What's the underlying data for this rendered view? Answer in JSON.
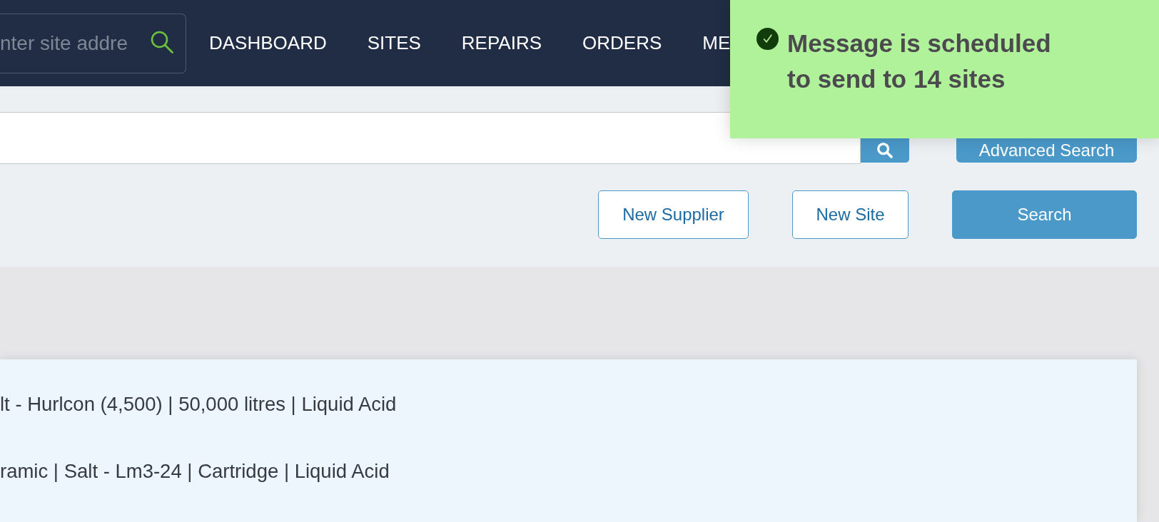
{
  "navbar": {
    "site_search": {
      "placeholder": "nter site addre"
    },
    "menu": [
      {
        "label": "DASHBOARD"
      },
      {
        "label": "SITES"
      },
      {
        "label": "REPAIRS"
      },
      {
        "label": "ORDERS"
      },
      {
        "label": "ME"
      }
    ]
  },
  "search_panel": {
    "advanced_button": "Advanced Search",
    "actions": [
      {
        "label": "New Supplier",
        "kind": "outline"
      },
      {
        "label": "New Site",
        "kind": "outline"
      },
      {
        "label": "Search",
        "kind": "primary"
      }
    ]
  },
  "results": [
    {
      "text": "lt - Hurlcon (4,500) | 50,000 litres | Liquid Acid"
    },
    {
      "text": "ramic | Salt - Lm3-24 | Cartridge | Liquid Acid"
    }
  ],
  "toast": {
    "kind": "success",
    "message": "Message is scheduled to send to 14 sites"
  }
}
